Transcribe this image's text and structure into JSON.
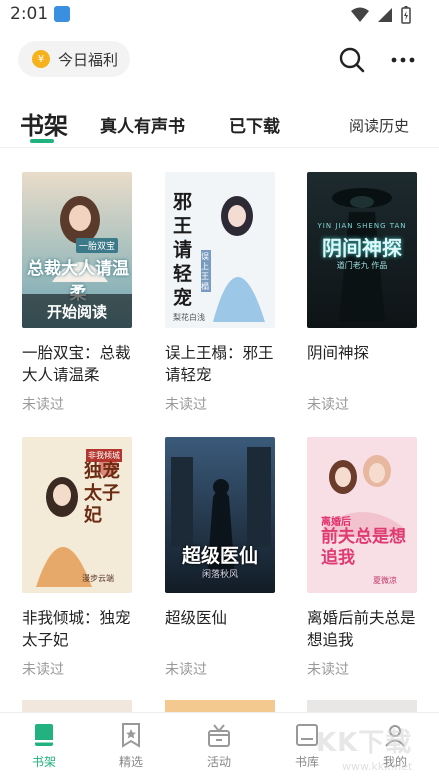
{
  "status_bar": {
    "time": "2:01"
  },
  "top_bar": {
    "welfare_label": "今日福利",
    "welfare_coin": "¥"
  },
  "tabs": {
    "bookshelf": "书架",
    "audio": "真人有声书",
    "downloaded": "已下载",
    "history": "阅读历史"
  },
  "books": [
    {
      "title": "一胎双宝：总裁大人请温柔",
      "status": "未读过",
      "cover_title": "总裁大人请温柔",
      "cover_badge": "一胎双宝",
      "cover_button": "开始阅读"
    },
    {
      "title": "误上王榻：邪王请轻宠",
      "status": "未读过",
      "cover_title": "邪王请轻宠",
      "cover_badge": "误上王榻",
      "cover_author": "梨花白浅"
    },
    {
      "title": "阴间神探",
      "status": "未读过",
      "cover_title": "阴间神探",
      "cover_pinyin": "YIN JIAN SHENG TAN",
      "cover_author": "道门老九 作品"
    },
    {
      "title": "非我倾城：独宠太子妃",
      "status": "未读过",
      "cover_title": "独宠太子妃",
      "cover_badge": "非我倾城",
      "cover_author": "漫步云端"
    },
    {
      "title": "超级医仙",
      "status": "未读过",
      "cover_title": "超级医仙",
      "cover_author": "闲落秋风"
    },
    {
      "title": "离婚后前夫总是想追我",
      "status": "未读过",
      "cover_title": "前夫总是想追我",
      "cover_badge": "离婚后",
      "cover_author": "夏微凉"
    }
  ],
  "nav": {
    "bookshelf": "书架",
    "featured": "精选",
    "activity": "活动",
    "library": "书库",
    "mine": "我的"
  },
  "watermark": {
    "text": "KK下载",
    "url": "www.kkx.net"
  },
  "colors": {
    "accent": "#21b27f",
    "coin": "#f6b21c",
    "muted": "#999999"
  }
}
